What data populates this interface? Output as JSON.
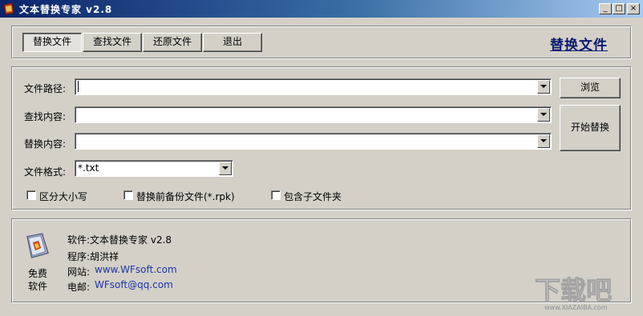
{
  "window": {
    "title": "文本替换专家 v2.8",
    "controls": [
      "_",
      "□",
      "×"
    ]
  },
  "toolbar": {
    "buttons": [
      {
        "label": "替换文件",
        "selected": true
      },
      {
        "label": "查找文件",
        "selected": false
      },
      {
        "label": "还原文件",
        "selected": false
      },
      {
        "label": "退出",
        "selected": false
      }
    ],
    "section_title": "替换文件"
  },
  "form": {
    "file_path": {
      "label": "文件路径:",
      "value": ""
    },
    "find": {
      "label": "查找内容:",
      "value": ""
    },
    "replace": {
      "label": "替换内容:",
      "value": ""
    },
    "format": {
      "label": "文件格式:",
      "value": "*.txt"
    },
    "browse_label": "浏览",
    "start_label": "开始替换",
    "options": [
      {
        "label": "区分大小写",
        "checked": false
      },
      {
        "label": "替换前备份文件(*.rpk)",
        "checked": false
      },
      {
        "label": "包含子文件夹",
        "checked": false
      }
    ]
  },
  "about": {
    "badge_line1": "免费",
    "badge_line2": "软件",
    "software": "软件:文本替换专家 v2.8",
    "author": "程序:胡洪祥",
    "website_label": "网站:",
    "website": "www.WFsoft.com",
    "email_label": "电邮:",
    "email": "WFsoft@qq.com"
  },
  "watermark": {
    "brand": "下载吧",
    "domain": "www.XIAZAIBA.com"
  },
  "colors": {
    "titlebar_start": "#0a246a",
    "titlebar_end": "#a6caf0",
    "face": "#d4d0c8",
    "link": "#1a35a8",
    "heading": "#0a1a6e"
  }
}
